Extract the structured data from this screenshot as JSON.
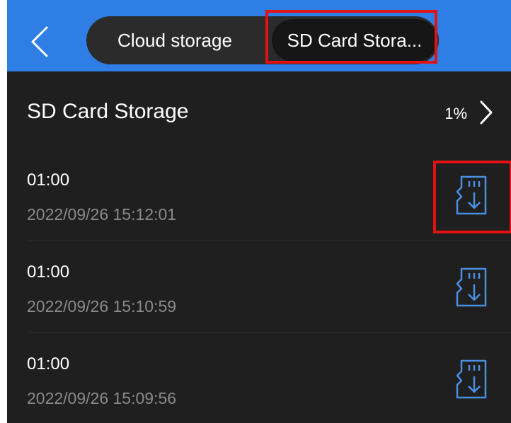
{
  "nav": {
    "tabs": [
      {
        "label": "Cloud storage"
      },
      {
        "label": "SD Card Stora..."
      }
    ]
  },
  "storage": {
    "title": "SD Card Storage",
    "usage": "1%"
  },
  "recordings": [
    {
      "duration": "01:00",
      "timestamp": "2022/09/26 15:12:01"
    },
    {
      "duration": "01:00",
      "timestamp": "2022/09/26 15:10:59"
    },
    {
      "duration": "01:00",
      "timestamp": "2022/09/26 15:09:56"
    }
  ],
  "colors": {
    "accent": "#2f7ee5",
    "background": "#1f1f1f",
    "icon": "#4a90e2",
    "highlight": "#e01212"
  },
  "icons": {
    "back": "chevron-left-icon",
    "more": "chevron-right-icon",
    "download": "sd-card-download-icon"
  }
}
